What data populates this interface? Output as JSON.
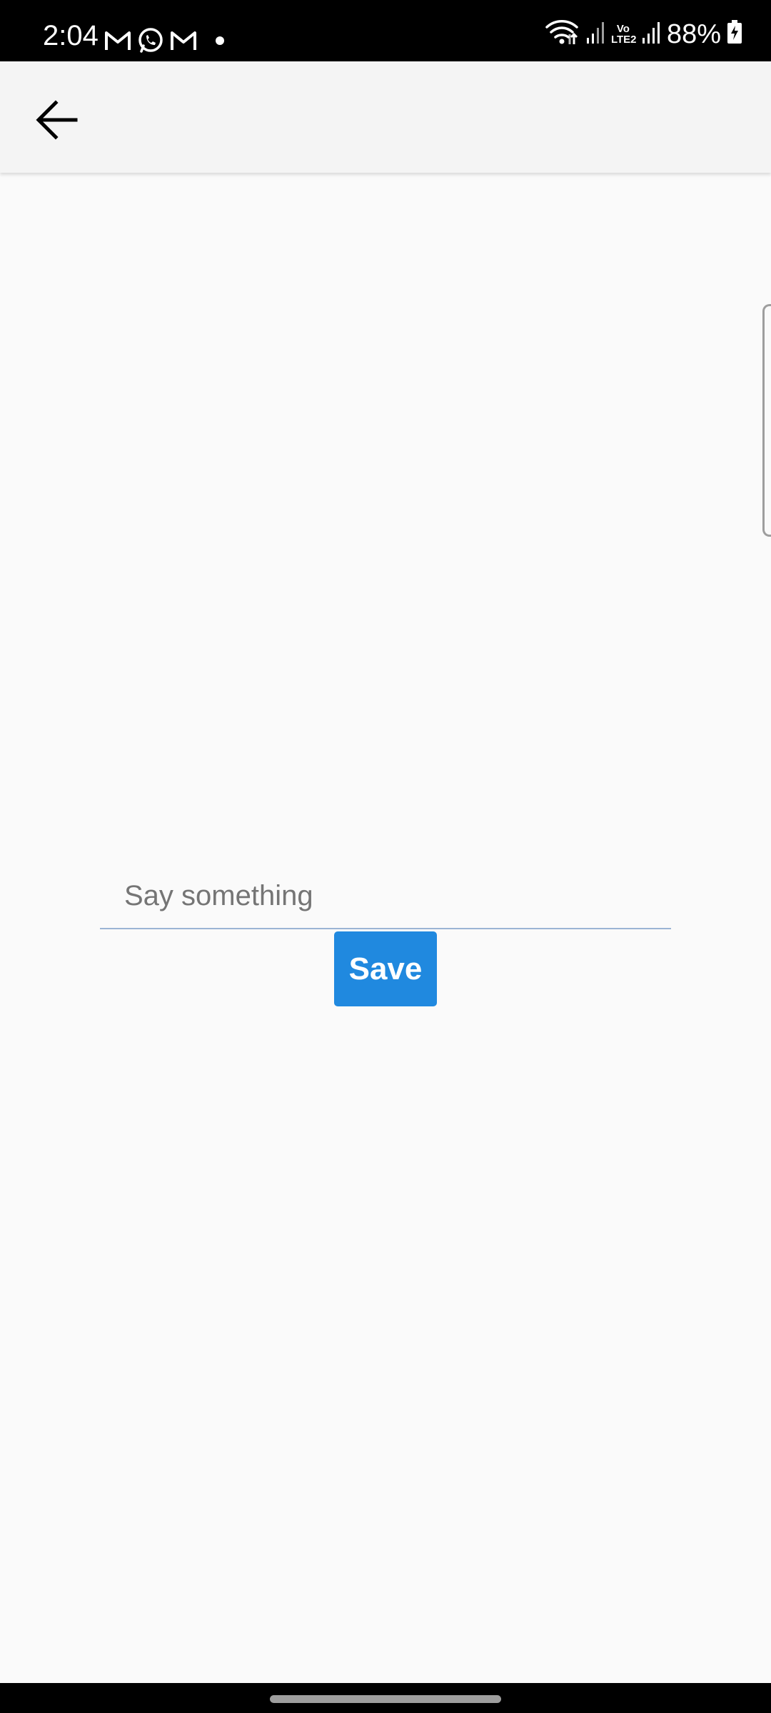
{
  "status_bar": {
    "time": "2:04",
    "battery_percent": "88%",
    "volte_label": "Vo LTE2",
    "notification_icons": [
      "gmail-icon",
      "whatsapp-icon",
      "gmail-icon",
      "dot-icon"
    ],
    "system_icons": [
      "wifi-icon",
      "signal-icon",
      "volte-icon",
      "signal-icon",
      "battery-charging-icon"
    ]
  },
  "app_bar": {
    "back_icon": "arrow-left-icon"
  },
  "form": {
    "input_placeholder": "Say something",
    "input_value": "",
    "save_label": "Save"
  },
  "colors": {
    "save_button": "#2089df",
    "input_underline": "#9bb4d4",
    "background": "#fafafa",
    "app_bar": "#f4f4f4"
  }
}
